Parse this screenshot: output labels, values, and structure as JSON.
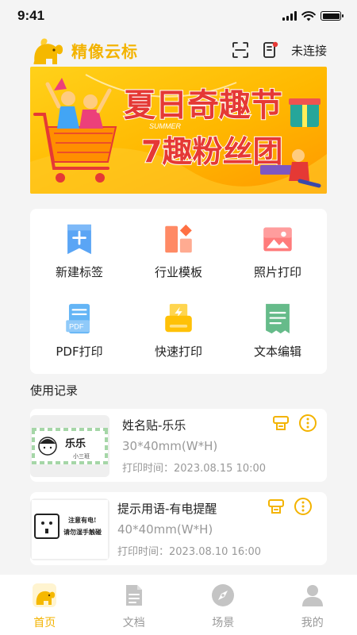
{
  "status_bar": {
    "time": "9:41"
  },
  "header": {
    "title": "精像云标",
    "connection": "未连接"
  },
  "banner": {
    "small_text": "SUMMER",
    "headline_line1": "夏日奇趣节",
    "headline_line2": "7趣粉丝团"
  },
  "grid": {
    "items": [
      {
        "label": "新建标签",
        "icon": "new-label-icon"
      },
      {
        "label": "行业模板",
        "icon": "industry-template-icon"
      },
      {
        "label": "照片打印",
        "icon": "photo-print-icon"
      },
      {
        "label": "PDF打印",
        "icon": "pdf-print-icon"
      },
      {
        "label": "快速打印",
        "icon": "quick-print-icon"
      },
      {
        "label": "文本编辑",
        "icon": "text-edit-icon"
      }
    ]
  },
  "section_title": "使用记录",
  "records": [
    {
      "title": "姓名贴-乐乐",
      "size": "30*40mm(W*H)",
      "time": "打印时间：2023.08.15 10:00",
      "thumb_name": "乐乐",
      "thumb_sub": "小三班"
    },
    {
      "title": "提示用语-有电提醒",
      "size": "40*40mm(W*H)",
      "time": "打印时间：2023.08.10 16:00",
      "thumb_line1": "注意有电!",
      "thumb_line2": "请勿湿手触碰"
    }
  ],
  "nav": {
    "items": [
      {
        "label": "首页",
        "icon": "home-elephant-icon",
        "active": true
      },
      {
        "label": "文档",
        "icon": "document-icon",
        "active": false
      },
      {
        "label": "场景",
        "icon": "compass-icon",
        "active": false
      },
      {
        "label": "我的",
        "icon": "user-icon",
        "active": false
      }
    ]
  },
  "colors": {
    "accent": "#f3b300",
    "muted": "#999999",
    "background": "#f4f4f4"
  }
}
